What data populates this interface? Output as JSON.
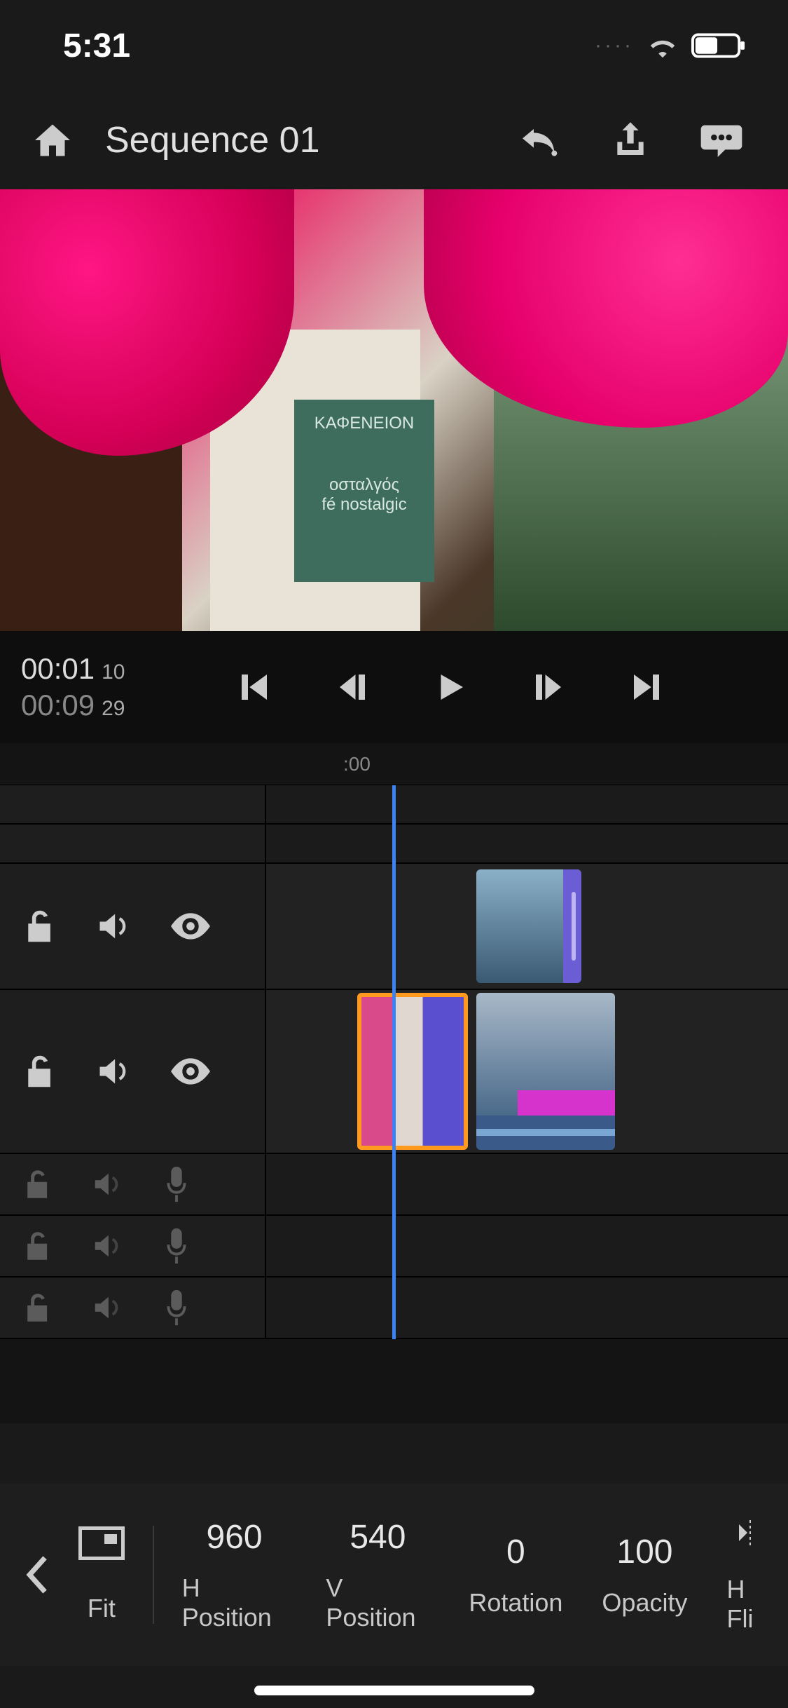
{
  "status": {
    "time": "5:31"
  },
  "header": {
    "title": "Sequence 01",
    "home_icon": "home-icon",
    "undo_icon": "undo-icon",
    "share_icon": "share-icon",
    "comment_icon": "comment-icon"
  },
  "preview_sign": {
    "line1": "ΚΑΦΕΝΕΙΟΝ",
    "line2": "οσταλγός",
    "line3": "fé nostalgic"
  },
  "playback": {
    "current_tc": "00:01",
    "current_frames": "10",
    "duration_tc": "00:09",
    "duration_frames": "29",
    "ruler_label": ":00"
  },
  "tracks": {
    "v1_icons": [
      "lock",
      "speaker",
      "eye"
    ],
    "v2_icons": [
      "lock",
      "speaker",
      "eye"
    ],
    "a_icons": [
      "lock",
      "speaker",
      "mic"
    ]
  },
  "properties": {
    "display_mode": "Fit",
    "items": [
      {
        "value": "960",
        "label": "H Position"
      },
      {
        "value": "540",
        "label": "V Position"
      },
      {
        "value": "0",
        "label": "Rotation"
      },
      {
        "value": "100",
        "label": "Opacity"
      },
      {
        "value": "",
        "label": "H Fli"
      }
    ]
  }
}
